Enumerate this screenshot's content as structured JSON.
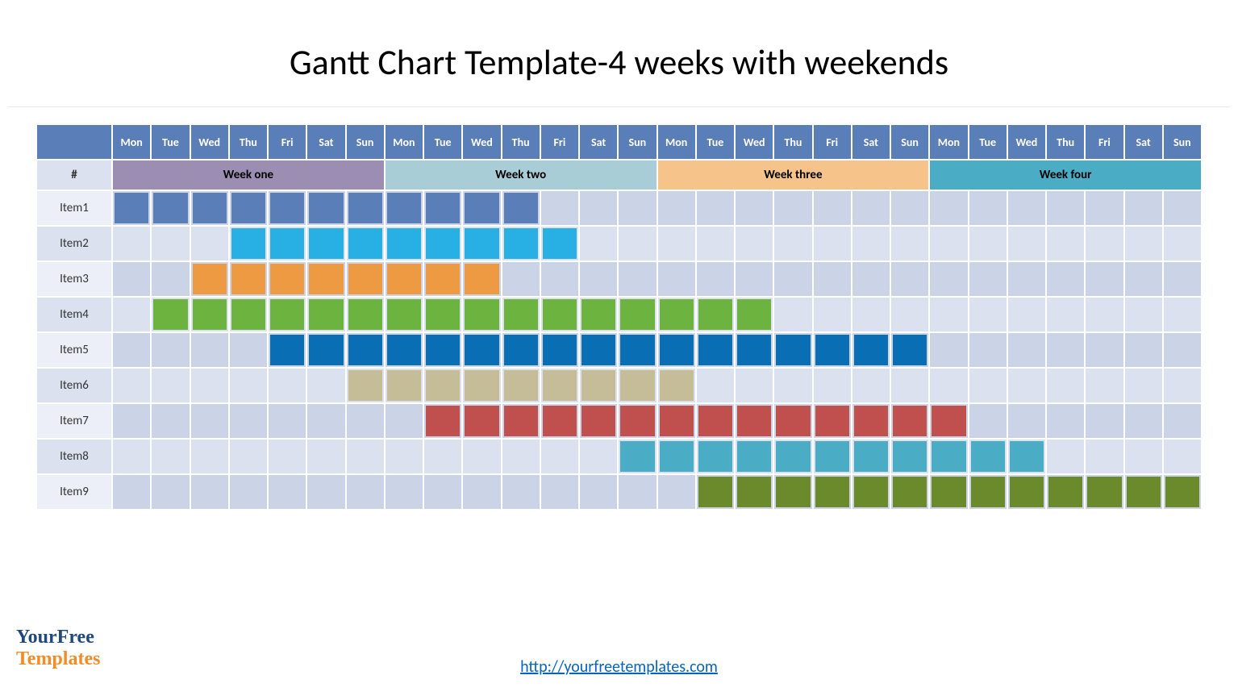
{
  "title": "Gantt Chart Template-4 weeks with weekends",
  "hash": "#",
  "days": [
    "Mon",
    "Tue",
    "Wed",
    "Thu",
    "Fri",
    "Sat",
    "Sun",
    "Mon",
    "Tue",
    "Wed",
    "Thu",
    "Fri",
    "Sat",
    "Sun",
    "Mon",
    "Tue",
    "Wed",
    "Thu",
    "Fri",
    "Sat",
    "Sun",
    "Mon",
    "Tue",
    "Wed",
    "Thu",
    "Fri",
    "Sat",
    "Sun"
  ],
  "weeks": [
    {
      "label": "Week one",
      "span": 7,
      "color": "#9c8eb2"
    },
    {
      "label": "Week two",
      "span": 7,
      "color": "#a9cdd7"
    },
    {
      "label": "Week three",
      "span": 7,
      "color": "#f6c48b"
    },
    {
      "label": "Week four",
      "span": 7,
      "color": "#4bacc6"
    }
  ],
  "items": [
    {
      "label": "Item1",
      "start": 1,
      "end": 11,
      "color": "#5a7eb8"
    },
    {
      "label": "Item2",
      "start": 4,
      "end": 12,
      "color": "#28b0e4"
    },
    {
      "label": "Item3",
      "start": 3,
      "end": 10,
      "color": "#ed9a43"
    },
    {
      "label": "Item4",
      "start": 2,
      "end": 17,
      "color": "#6cb33f"
    },
    {
      "label": "Item5",
      "start": 5,
      "end": 21,
      "color": "#0a6eb4"
    },
    {
      "label": "Item6",
      "start": 7,
      "end": 15,
      "color": "#c4bd97"
    },
    {
      "label": "Item7",
      "start": 9,
      "end": 22,
      "color": "#c0504d"
    },
    {
      "label": "Item8",
      "start": 14,
      "end": 24,
      "color": "#4bacc6"
    },
    {
      "label": "Item9",
      "start": 16,
      "end": 28,
      "color": "#6a8a2c"
    }
  ],
  "footer_link": "http://yourfreetemplates.com",
  "logo": {
    "line1a": "Your",
    "line1b": "Free",
    "line2": "Templates"
  },
  "chart_data": {
    "type": "gantt",
    "title": "Gantt Chart Template-4 weeks with weekends",
    "time_axis": {
      "unit": "day",
      "total": 28,
      "labels": [
        "Mon",
        "Tue",
        "Wed",
        "Thu",
        "Fri",
        "Sat",
        "Sun",
        "Mon",
        "Tue",
        "Wed",
        "Thu",
        "Fri",
        "Sat",
        "Sun",
        "Mon",
        "Tue",
        "Wed",
        "Thu",
        "Fri",
        "Sat",
        "Sun",
        "Mon",
        "Tue",
        "Wed",
        "Thu",
        "Fri",
        "Sat",
        "Sun"
      ]
    },
    "groups": [
      {
        "name": "Week one",
        "start": 1,
        "end": 7
      },
      {
        "name": "Week two",
        "start": 8,
        "end": 14
      },
      {
        "name": "Week three",
        "start": 15,
        "end": 21
      },
      {
        "name": "Week four",
        "start": 22,
        "end": 28
      }
    ],
    "tasks": [
      {
        "name": "Item1",
        "start": 1,
        "end": 11,
        "color": "#5a7eb8"
      },
      {
        "name": "Item2",
        "start": 4,
        "end": 12,
        "color": "#28b0e4"
      },
      {
        "name": "Item3",
        "start": 3,
        "end": 10,
        "color": "#ed9a43"
      },
      {
        "name": "Item4",
        "start": 2,
        "end": 17,
        "color": "#6cb33f"
      },
      {
        "name": "Item5",
        "start": 5,
        "end": 21,
        "color": "#0a6eb4"
      },
      {
        "name": "Item6",
        "start": 7,
        "end": 15,
        "color": "#c4bd97"
      },
      {
        "name": "Item7",
        "start": 9,
        "end": 22,
        "color": "#c0504d"
      },
      {
        "name": "Item8",
        "start": 14,
        "end": 24,
        "color": "#4bacc6"
      },
      {
        "name": "Item9",
        "start": 16,
        "end": 28,
        "color": "#6a8a2c"
      }
    ]
  }
}
